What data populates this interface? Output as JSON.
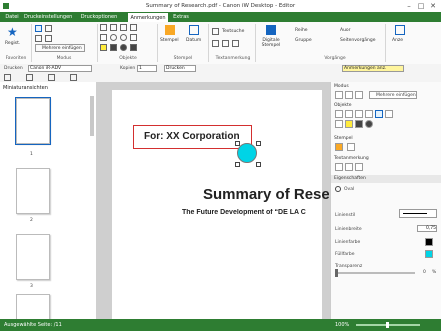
{
  "window": {
    "title": "Summary of Research.pdf - Canon iW Desktop - Editor"
  },
  "tabs": [
    "Datei",
    "Druckeinstellungen",
    "Druckoptionen",
    "Anmerkungen",
    "Extras"
  ],
  "ribbon": {
    "regist_label": "Regist.",
    "mehrere_label": "Mehrere einfügen",
    "stempel_label": "Stempel",
    "datum_label": "Datum",
    "textsuche_label": "Textsuche",
    "digitale_label": "Digitale Stempel",
    "reihe_label": "Reihe",
    "auor_label": "Auor",
    "gruppe_label": "Gruppe",
    "seitenvorgaenge_label": "Seitenvorgänge",
    "anze_label": "Anze",
    "groups": [
      "Favoriten",
      "Modus",
      "Objekte",
      "Stempel",
      "Textanmerkung",
      "Vorgänge"
    ]
  },
  "toolbar": {
    "drucken_label": "Drucken",
    "printer_value": "Canon iR-ADV",
    "kopien_label": "Kopien",
    "kopien_value": "1",
    "drucken_btn": "Drucken",
    "anmerkungen_btn": "Anmerkungen anz."
  },
  "leftpane": {
    "title": "Miniaturansichten",
    "pages": [
      "1",
      "2",
      "3"
    ]
  },
  "document": {
    "box_text": "For: XX Corporation",
    "title": "Summary of Rese",
    "subtitle": "The Future Development of “DE LA C"
  },
  "rightpane": {
    "modus_title": "Modus",
    "mehrere_label": "Mehrere einfügen",
    "objekte_title": "Objekte",
    "stempel_title": "Stempel",
    "textanmerkung_title": "Textanmerkung",
    "eigenschaften_title": "Eigenschaften",
    "oval_label": "Oval",
    "linienstil_label": "Linienstil",
    "linienbreite_label": "Linienbreite",
    "linienbreite_value": "0,75",
    "linienfarbe_label": "Linienfarbe",
    "fuellfarbe_label": "Füllfarbe",
    "transparenz_label": "Transparenz",
    "transparenz_value": "0",
    "percent": "%"
  },
  "status": {
    "left": "Ausgewählte Seite: /11",
    "zoom": "100%"
  },
  "colors": {
    "accent": "#2e7d32",
    "circle": "#00d4e6",
    "box": "#d32f2f"
  }
}
